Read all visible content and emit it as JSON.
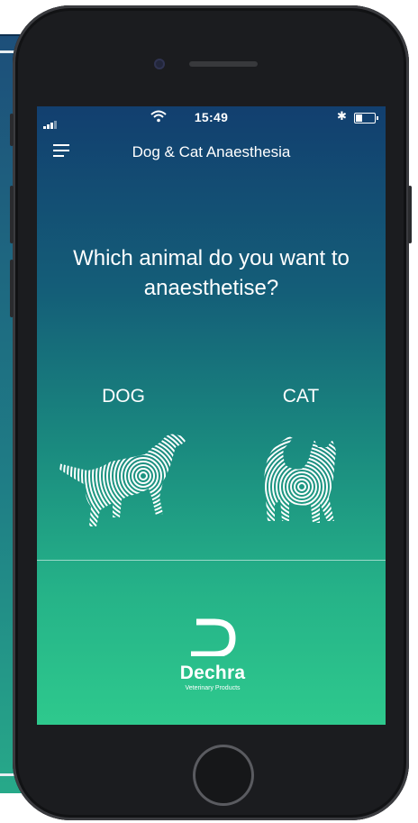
{
  "status_bar": {
    "time": "15:49",
    "wifi_icon": "wifi-icon",
    "bluetooth_icon": "bluetooth-icon",
    "battery_icon": "battery-icon"
  },
  "nav": {
    "title": "Dog & Cat Anaesthesia",
    "menu_icon": "hamburger-menu-icon"
  },
  "question": "Which animal do you want to anaesthetise?",
  "choices": [
    {
      "label": "DOG",
      "icon": "dog-fingerprint-icon"
    },
    {
      "label": "CAT",
      "icon": "cat-fingerprint-icon"
    }
  ],
  "logo": {
    "brand": "Dechra",
    "tagline": "Veterinary Products"
  },
  "colors": {
    "gradient_top": "#123f6f",
    "gradient_bottom": "#2ec98d",
    "text": "#ffffff"
  }
}
